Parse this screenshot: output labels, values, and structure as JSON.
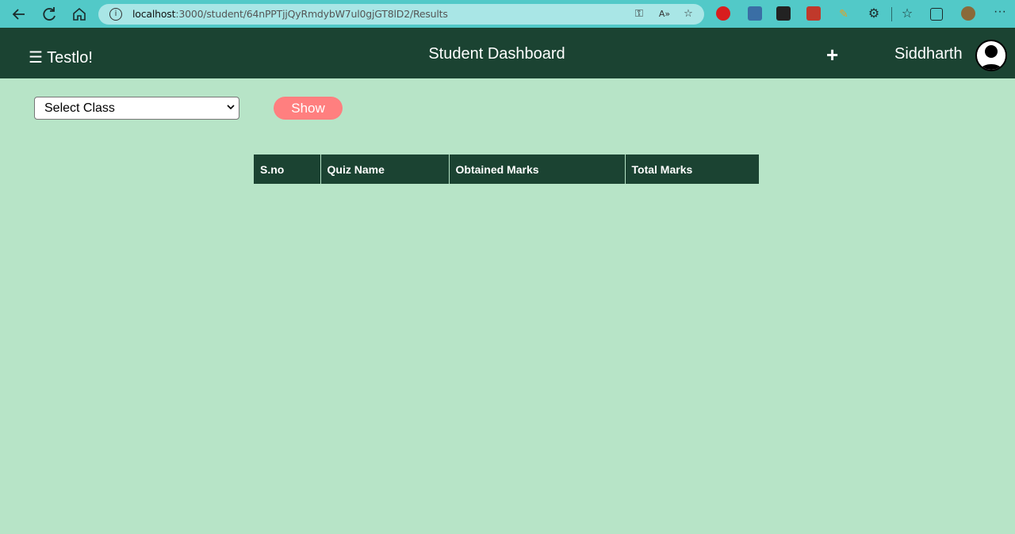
{
  "browser": {
    "url_host": "localhost",
    "url_rest": ":3000/student/64nPPTjjQyRmdybW7ul0gjGT8lD2/Results"
  },
  "header": {
    "brand": "☰ Testlo!",
    "title": "Student Dashboard",
    "add_label": "+",
    "user_name": "Siddharth"
  },
  "controls": {
    "class_select_value": "Select Class",
    "show_button": "Show"
  },
  "table": {
    "columns": [
      "S.no",
      "Quiz Name",
      "Obtained Marks",
      "Total Marks"
    ]
  },
  "colors": {
    "background": "#b7e4c7",
    "header": "#1b4332",
    "show_button": "#ff7f7f",
    "browser_bar": "#52c9c8"
  }
}
